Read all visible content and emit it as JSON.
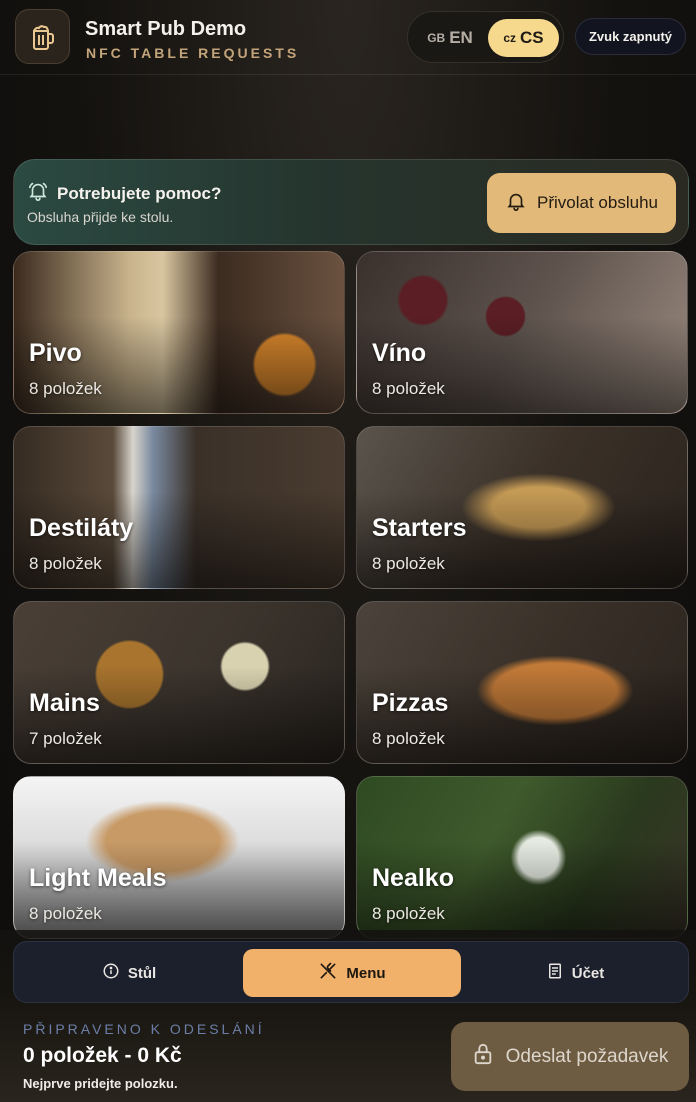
{
  "header": {
    "title": "Smart Pub Demo",
    "subtitle": "NFC TABLE REQUESTS",
    "logo_icon": "beer-mug-icon",
    "languages": [
      {
        "code": "GB",
        "label": "EN",
        "active": false
      },
      {
        "code": "CZ",
        "label": "CS",
        "active": true
      }
    ],
    "sound_label": "Zvuk zapnutý"
  },
  "help": {
    "icon": "bell-icon",
    "title": "Potrebujete pomoc?",
    "subtitle": "Obsluha přijde ke stolu.",
    "button_label": "Přivolat obsluhu"
  },
  "categories": [
    {
      "name": "Pivo",
      "count": "8 položek"
    },
    {
      "name": "Víno",
      "count": "8 položek"
    },
    {
      "name": "Destiláty",
      "count": "8 položek"
    },
    {
      "name": "Starters",
      "count": "8 položek"
    },
    {
      "name": "Mains",
      "count": "7 položek"
    },
    {
      "name": "Pizzas",
      "count": "8 položek"
    },
    {
      "name": "Light Meals",
      "count": "8 položek"
    },
    {
      "name": "Nealko",
      "count": "8 položek"
    }
  ],
  "tabs": [
    {
      "label": "Stůl",
      "icon": "info-icon",
      "active": false
    },
    {
      "label": "Menu",
      "icon": "utensils-icon",
      "active": true
    },
    {
      "label": "Účet",
      "icon": "receipt-icon",
      "active": false
    }
  ],
  "order": {
    "status_label": "PŘIPRAVENO K ODESLÁNÍ",
    "total": "0 položek - 0 Kč",
    "hint": "Nejprve pridejte polozku.",
    "send_label": "Odeslat požadavek"
  },
  "colors": {
    "accent": "#f2b16a",
    "lang_active": "#f7d98e",
    "call_button": "#e2b978"
  }
}
